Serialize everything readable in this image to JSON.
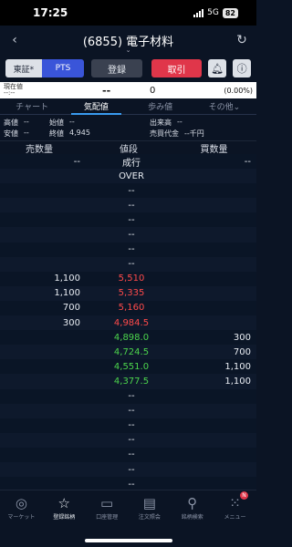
{
  "status": {
    "time": "17:25",
    "network": "5G",
    "battery": "82"
  },
  "header": {
    "title": "(6855) 電子材料"
  },
  "buttons": {
    "tse": "東証*",
    "pts": "PTS",
    "register": "登録",
    "trade": "取引"
  },
  "price": {
    "label_line1": "現在値",
    "label_line2": "--:--",
    "current": "--",
    "change": "0",
    "change_pct": "(0.00%)"
  },
  "tabs": [
    "チャート",
    "気配値",
    "歩み値",
    "その他⌄"
  ],
  "info": {
    "high_label": "高値",
    "high": "--",
    "open_label": "始値",
    "open": "--",
    "volume_label": "出来高",
    "volume": "--",
    "low_label": "安値",
    "low": "--",
    "close_label": "終値",
    "close": "4,945",
    "turnover_label": "売買代金",
    "turnover": "--千円"
  },
  "board_header": {
    "sell": "売数量",
    "price": "値段",
    "buy": "買数量"
  },
  "board": [
    {
      "sell": "--",
      "price": "成行",
      "buy": "--",
      "color": ""
    },
    {
      "sell": "",
      "price": "OVER",
      "buy": "",
      "color": ""
    },
    {
      "sell": "",
      "price": "--",
      "buy": "",
      "color": ""
    },
    {
      "sell": "",
      "price": "--",
      "buy": "",
      "color": ""
    },
    {
      "sell": "",
      "price": "--",
      "buy": "",
      "color": ""
    },
    {
      "sell": "",
      "price": "--",
      "buy": "",
      "color": ""
    },
    {
      "sell": "",
      "price": "--",
      "buy": "",
      "color": ""
    },
    {
      "sell": "",
      "price": "--",
      "buy": "",
      "color": ""
    },
    {
      "sell": "1,100",
      "price": "5,510",
      "buy": "",
      "color": "red"
    },
    {
      "sell": "1,100",
      "price": "5,335",
      "buy": "",
      "color": "red"
    },
    {
      "sell": "700",
      "price": "5,160",
      "buy": "",
      "color": "red"
    },
    {
      "sell": "300",
      "price": "4,984.5",
      "buy": "",
      "color": "red"
    },
    {
      "sell": "",
      "price": "4,898.0",
      "buy": "300",
      "color": "green"
    },
    {
      "sell": "",
      "price": "4,724.5",
      "buy": "700",
      "color": "green"
    },
    {
      "sell": "",
      "price": "4,551.0",
      "buy": "1,100",
      "color": "green"
    },
    {
      "sell": "",
      "price": "4,377.5",
      "buy": "1,100",
      "color": "green"
    },
    {
      "sell": "",
      "price": "--",
      "buy": "",
      "color": ""
    },
    {
      "sell": "",
      "price": "--",
      "buy": "",
      "color": ""
    },
    {
      "sell": "",
      "price": "--",
      "buy": "",
      "color": ""
    },
    {
      "sell": "",
      "price": "--",
      "buy": "",
      "color": ""
    },
    {
      "sell": "",
      "price": "--",
      "buy": "",
      "color": ""
    },
    {
      "sell": "",
      "price": "--",
      "buy": "",
      "color": ""
    },
    {
      "sell": "",
      "price": "--",
      "buy": "",
      "color": ""
    }
  ],
  "bottom_nav": [
    {
      "label": "マーケット",
      "icon": "globe-icon",
      "glyph": "◎"
    },
    {
      "label": "登録銘柄",
      "icon": "star-icon",
      "glyph": "☆"
    },
    {
      "label": "口座管理",
      "icon": "card-icon",
      "glyph": "▭"
    },
    {
      "label": "注文照会",
      "icon": "document-icon",
      "glyph": "▤"
    },
    {
      "label": "銘柄検索",
      "icon": "search-icon",
      "glyph": "⚲"
    },
    {
      "label": "メニュー",
      "icon": "menu-grid-icon",
      "glyph": "⁙",
      "badge": "N"
    }
  ],
  "colors": {
    "up": "#ff4a4a",
    "down": "#4cd44c",
    "accent": "#3a55d9",
    "trade": "#e0364a"
  }
}
